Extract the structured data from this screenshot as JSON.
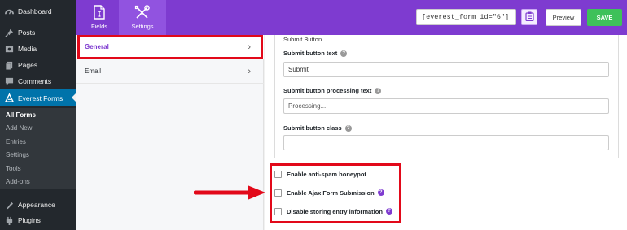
{
  "sidebar": {
    "items": [
      {
        "label": "Dashboard",
        "icon": "dashboard-icon"
      },
      {
        "label": "Posts",
        "icon": "pin-icon"
      },
      {
        "label": "Media",
        "icon": "media-icon"
      },
      {
        "label": "Pages",
        "icon": "pages-icon"
      },
      {
        "label": "Comments",
        "icon": "comments-icon"
      },
      {
        "label": "Everest Forms",
        "icon": "forms-icon"
      },
      {
        "label": "Appearance",
        "icon": "appearance-icon"
      },
      {
        "label": "Plugins",
        "icon": "plugins-icon"
      }
    ],
    "submenu": [
      "All Forms",
      "Add New",
      "Entries",
      "Settings",
      "Tools",
      "Add-ons"
    ]
  },
  "topbar": {
    "tabs": [
      {
        "label": "Fields",
        "icon": "fields-icon"
      },
      {
        "label": "Settings",
        "icon": "settings-tools-icon"
      }
    ],
    "shortcode": "[everest_form id=\"6\"]",
    "preview_label": "Preview",
    "save_label": "SAVE",
    "accent_color": "#7e3bd0",
    "save_color": "#3ec15a"
  },
  "settings_nav": {
    "items": [
      {
        "label": "General"
      },
      {
        "label": "Email"
      }
    ]
  },
  "main": {
    "submit_section_title": "Submit Button",
    "fields": [
      {
        "label": "Submit button text",
        "value": "Submit",
        "placeholder": ""
      },
      {
        "label": "Submit button processing text",
        "value": "",
        "placeholder": "Processing..."
      },
      {
        "label": "Submit button class",
        "value": "",
        "placeholder": ""
      }
    ],
    "checkboxes": [
      {
        "label": "Enable anti-spam honeypot",
        "checked": false,
        "help": false
      },
      {
        "label": "Enable Ajax Form Submission",
        "checked": false,
        "help": true
      },
      {
        "label": "Disable storing entry information",
        "checked": false,
        "help": true
      }
    ]
  },
  "annotation_color": "#e2091a"
}
